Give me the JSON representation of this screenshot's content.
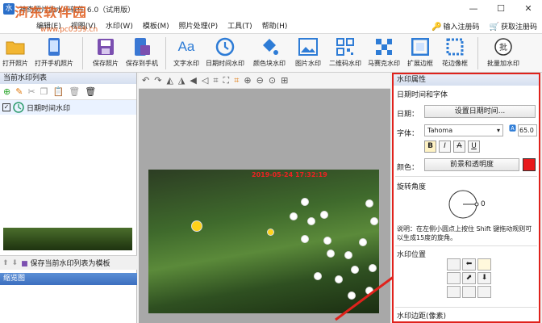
{
  "titlebar": {
    "title": "神奇照片加水印软件 6.0（试用版）",
    "watermark": "河东软件园",
    "watermark_url": "www.pc0359.cn",
    "minimize": "—",
    "maximize": "☐",
    "close": "✕"
  },
  "menu": {
    "items": [
      "编辑(E)",
      "视图(V)",
      "水印(W)",
      "模板(M)",
      "照片处理(P)",
      "工具(T)",
      "帮助(H)"
    ],
    "register": "输入注册码",
    "get_code": "获取注册码"
  },
  "toolbar": {
    "items": [
      {
        "label": "打开照片",
        "icon": "folder-icon"
      },
      {
        "label": "打开手机照片",
        "icon": "phone-icon"
      },
      {
        "label": "保存照片",
        "icon": "save-icon"
      },
      {
        "label": "保存到手机",
        "icon": "save-phone-icon"
      },
      {
        "label": "文字水印",
        "icon": "text-icon"
      },
      {
        "label": "日期时间水印",
        "icon": "clock-icon"
      },
      {
        "label": "颜色块水印",
        "icon": "paint-bucket-icon"
      },
      {
        "label": "图片水印",
        "icon": "image-icon"
      },
      {
        "label": "二维码水印",
        "icon": "qrcode-icon"
      },
      {
        "label": "马赛克水印",
        "icon": "mosaic-icon"
      },
      {
        "label": "扩展边框",
        "icon": "border-icon"
      },
      {
        "label": "花边像框",
        "icon": "frame-icon"
      },
      {
        "label": "批量加水印",
        "icon": "batch-icon"
      }
    ]
  },
  "left": {
    "header": "当前水印列表",
    "item": "日期时间水印",
    "save_template": "保存当前水印列表为模板",
    "thumb_header": "缩览图"
  },
  "photo": {
    "overlay_text": "2019-05-24 17:32:19"
  },
  "right": {
    "header": "水印属性",
    "sec_date_font": "日期时间和字体",
    "date_label": "日期：",
    "date_button": "设置日期时间...",
    "font_label": "字体：",
    "font_value": "Tahoma",
    "font_size": "65.0",
    "bold": "B",
    "italic": "I",
    "strike": "A",
    "underline": "U",
    "color_label": "颜色：",
    "color_button": "前景和透明度",
    "color_swatch": "#e8191b",
    "sec_rotate": "旋转角度",
    "rotate_value": "0",
    "note": "说明：在左侧小圆点上按住 Shift 键拖动规则可以生成15度的旋角。",
    "sec_position": "水印位置",
    "sec_margin": "水印边距(像素)"
  },
  "colors": {
    "accent": "#e0221c",
    "menu_bar_bg": "#ffffff"
  }
}
